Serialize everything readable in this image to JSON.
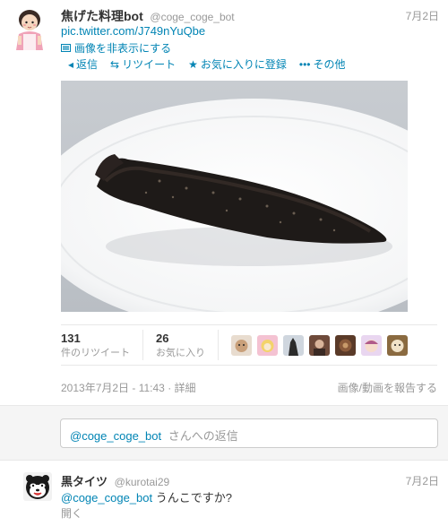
{
  "tweet": {
    "display_name": "焦げた料理bot",
    "handle": "@coge_coge_bot",
    "date": "7月2日",
    "link_text": "pic.twitter.com/J749nYuQbe",
    "hide_image": "画像を非表示にする",
    "actions": {
      "reply": "返信",
      "retweet": "リツイート",
      "favorite": "お気に入りに登録",
      "more": "その他"
    },
    "photo_icon": "burnt-food-photo",
    "stats": {
      "retweets_count": "131",
      "retweets_label": "件のリツイート",
      "favorites_count": "26",
      "favorites_label": "お気に入り"
    },
    "timestamp": "2013年7月2日 - 11:43",
    "details_link": "詳細",
    "report_link": "画像/動画を報告する"
  },
  "reply_box": {
    "mention": "@coge_coge_bot",
    "placeholder": "さんへの返信"
  },
  "reply_tweet": {
    "display_name": "黒タイツ",
    "handle": "@kurotai29",
    "date": "7月2日",
    "mention": "@coge_coge_bot",
    "text": "うんこですか?",
    "open": "開く"
  },
  "colors": {
    "link": "#0084b4",
    "muted": "#999999",
    "text": "#333333"
  }
}
